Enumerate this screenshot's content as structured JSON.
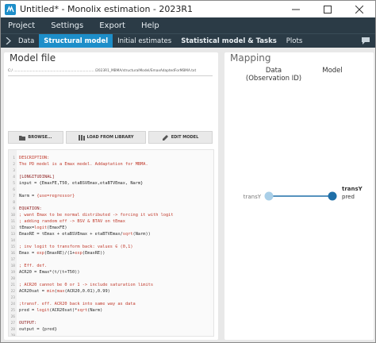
{
  "window": {
    "title": "Untitled* - Monolix estimation - 2023R1",
    "controls": [
      "minimize-icon",
      "maximize-icon",
      "close-icon"
    ]
  },
  "menu": {
    "items": [
      "Project",
      "Settings",
      "Export",
      "Help"
    ]
  },
  "tabs": [
    {
      "label": "Data",
      "active": false
    },
    {
      "label": "Structural model",
      "active": true
    },
    {
      "label": "Initial estimates",
      "active": false
    },
    {
      "label": "Statistical model & Tasks",
      "active": false
    },
    {
      "label": "Plots",
      "active": false
    }
  ],
  "model_file": {
    "title": "Model file",
    "path": "C:/ .......................................................................... /2023R1_MBMA/structuralModel/EmaxAdaptedForMBMA.txt",
    "buttons": {
      "browse": "BROWSE...",
      "load_library": "LOAD FROM LIBRARY",
      "edit": "EDIT MODEL"
    },
    "code": [
      {
        "n": "1",
        "parts": [
          {
            "c": "cm",
            "t": "DESCRIPTION:"
          }
        ]
      },
      {
        "n": "2",
        "parts": [
          {
            "c": "cm",
            "t": "The PD model is a Emax model. Addaptation for MBMA."
          }
        ]
      },
      {
        "n": "3",
        "parts": []
      },
      {
        "n": "4",
        "parts": [
          {
            "c": "kw",
            "t": "[LONGITUDINAL]"
          }
        ]
      },
      {
        "n": "5",
        "parts": [
          {
            "c": "tx",
            "t": "input = {EmaxFE,T50, etaBSVEmax,etaBTVEmax, Narm}"
          }
        ]
      },
      {
        "n": "6",
        "parts": []
      },
      {
        "n": "7",
        "parts": [
          {
            "c": "tx",
            "t": "Narm = "
          },
          {
            "c": "cm",
            "t": "{use=regressor}"
          }
        ]
      },
      {
        "n": "8",
        "parts": []
      },
      {
        "n": "9",
        "parts": [
          {
            "c": "kw",
            "t": "EQUATION:"
          }
        ]
      },
      {
        "n": "10",
        "parts": [
          {
            "c": "cm",
            "t": "; want Emax to be normal distributed -> forcing it with logit"
          }
        ]
      },
      {
        "n": "11",
        "parts": [
          {
            "c": "cm",
            "t": "; adding random eff -> BSV & BTAV on tEmax"
          }
        ]
      },
      {
        "n": "12",
        "parts": [
          {
            "c": "tx",
            "t": "tEmax="
          },
          {
            "c": "fn",
            "t": "logit"
          },
          {
            "c": "tx",
            "t": "(EmaxFE)"
          }
        ]
      },
      {
        "n": "13",
        "parts": [
          {
            "c": "tx",
            "t": "EmaxRE = tEmax + etaBSVEmax + etaBTVEmax/"
          },
          {
            "c": "fn",
            "t": "sqrt"
          },
          {
            "c": "tx",
            "t": "(Narm))"
          }
        ]
      },
      {
        "n": "14",
        "parts": []
      },
      {
        "n": "15",
        "parts": [
          {
            "c": "cm",
            "t": "; inv logit to transform back: values ∈ (0,1)"
          }
        ]
      },
      {
        "n": "16",
        "parts": [
          {
            "c": "tx",
            "t": "Emax = "
          },
          {
            "c": "fn",
            "t": "exp"
          },
          {
            "c": "tx",
            "t": "(EmaxRE)/(1+"
          },
          {
            "c": "fn",
            "t": "exp"
          },
          {
            "c": "tx",
            "t": "(EmaxRE))"
          }
        ]
      },
      {
        "n": "17",
        "parts": []
      },
      {
        "n": "18",
        "parts": [
          {
            "c": "cm",
            "t": "; Eff. def."
          }
        ]
      },
      {
        "n": "19",
        "parts": [
          {
            "c": "tx",
            "t": "ACR20 = Emax*(t/(t+T50))"
          }
        ]
      },
      {
        "n": "20",
        "parts": []
      },
      {
        "n": "21",
        "parts": [
          {
            "c": "cm",
            "t": "; ACR20 cannot be 0 or 1 -> include saturation limits"
          }
        ]
      },
      {
        "n": "22",
        "parts": [
          {
            "c": "tx",
            "t": "ACR20sat = "
          },
          {
            "c": "fn",
            "t": "min"
          },
          {
            "c": "tx",
            "t": "("
          },
          {
            "c": "fn",
            "t": "max"
          },
          {
            "c": "tx",
            "t": "(ACR20,0.01),0.99)"
          }
        ]
      },
      {
        "n": "23",
        "parts": []
      },
      {
        "n": "24",
        "parts": [
          {
            "c": "cm",
            "t": ";transf. eff. ACR20 back into same way as data"
          }
        ]
      },
      {
        "n": "25",
        "parts": [
          {
            "c": "tx",
            "t": "pred = "
          },
          {
            "c": "fn",
            "t": "logit"
          },
          {
            "c": "tx",
            "t": "(ACR20sat)*"
          },
          {
            "c": "fn",
            "t": "sqrt"
          },
          {
            "c": "tx",
            "t": "(Narm)"
          }
        ]
      },
      {
        "n": "26",
        "parts": []
      },
      {
        "n": "27",
        "parts": [
          {
            "c": "kw",
            "t": "OUTPUT:"
          }
        ]
      },
      {
        "n": "28",
        "parts": [
          {
            "c": "tx",
            "t": "output = {pred}"
          }
        ]
      },
      {
        "n": "29",
        "parts": []
      }
    ]
  },
  "mapping": {
    "title": "Mapping",
    "data_header": "Data",
    "data_subheader": "(Observation ID)",
    "model_header": "Model",
    "data_node_label": "transY",
    "model_node_label": "transY",
    "model_node_sublabel": "pred",
    "colors": {
      "data_node": "#a9cfe8",
      "model_node": "#1f6fa8",
      "link": "#1f6fa8"
    }
  }
}
